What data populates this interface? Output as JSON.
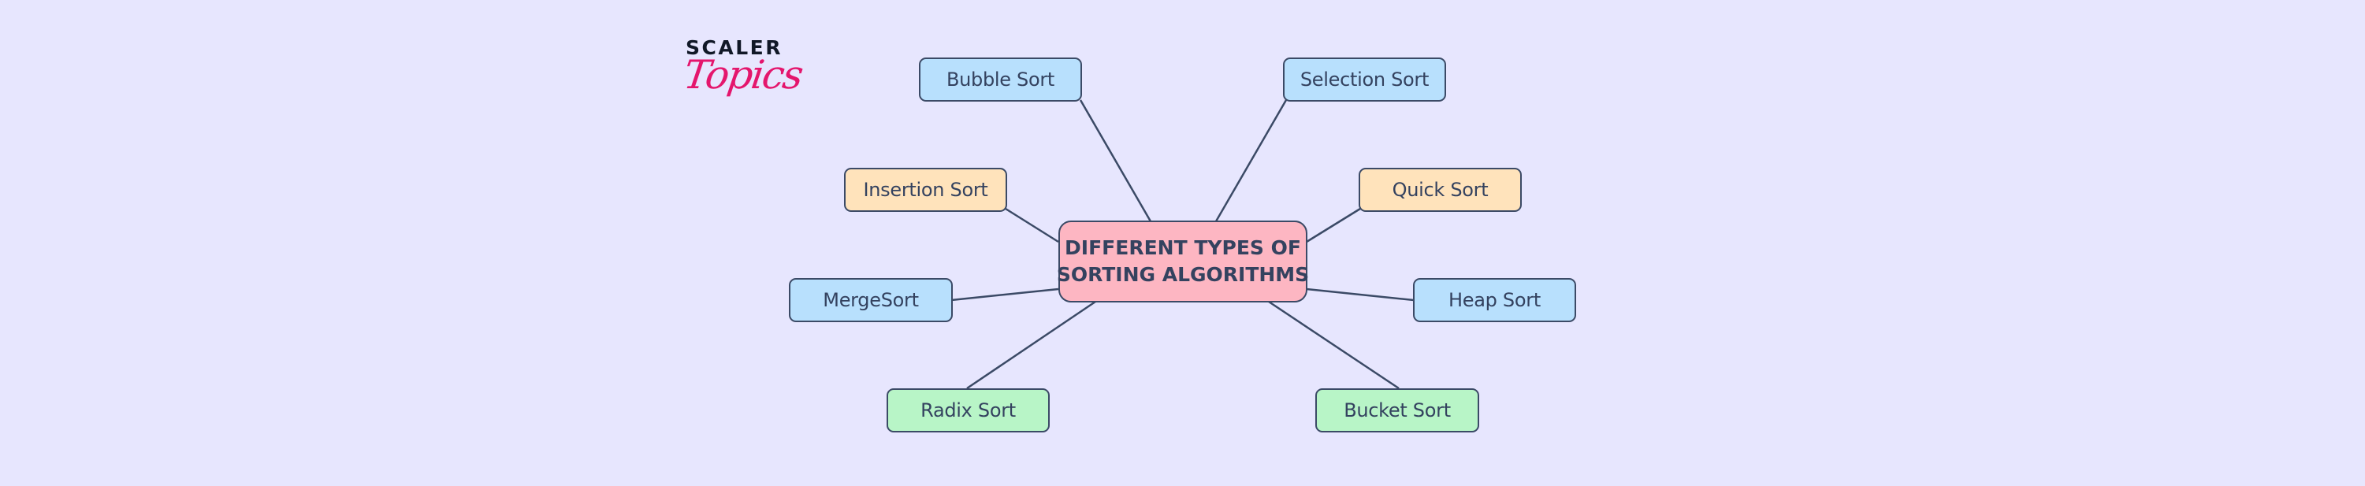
{
  "logo": {
    "word": "SCALER",
    "script": "Topics",
    "word_color": "#111827",
    "script_color": "#e4166d"
  },
  "diagram": {
    "background": "#e7e6fe",
    "edge_color": "#3b4a66",
    "center": {
      "id": "center",
      "line1": "DIFFERENT TYPES OF",
      "line2": "SORTING ALGORITHMS",
      "fill": "#fdb6c2"
    },
    "nodes": [
      {
        "id": "bubble-sort",
        "label": "Bubble Sort",
        "fill": "#b8e0fd"
      },
      {
        "id": "selection-sort",
        "label": "Selection Sort",
        "fill": "#b8e0fd"
      },
      {
        "id": "insertion-sort",
        "label": "Insertion Sort",
        "fill": "#ffe3bb"
      },
      {
        "id": "quick-sort",
        "label": "Quick Sort",
        "fill": "#ffe3bb"
      },
      {
        "id": "merge-sort",
        "label": "MergeSort",
        "fill": "#b8e0fd"
      },
      {
        "id": "heap-sort",
        "label": "Heap Sort",
        "fill": "#b8e0fd"
      },
      {
        "id": "radix-sort",
        "label": "Radix Sort",
        "fill": "#b8f5c7"
      },
      {
        "id": "bucket-sort",
        "label": "Bucket Sort",
        "fill": "#b8f5c7"
      }
    ],
    "edges": [
      {
        "from": "center",
        "to": "bubble-sort"
      },
      {
        "from": "center",
        "to": "selection-sort"
      },
      {
        "from": "center",
        "to": "insertion-sort"
      },
      {
        "from": "center",
        "to": "quick-sort"
      },
      {
        "from": "center",
        "to": "merge-sort"
      },
      {
        "from": "center",
        "to": "heap-sort"
      },
      {
        "from": "center",
        "to": "radix-sort"
      },
      {
        "from": "center",
        "to": "bucket-sort"
      }
    ]
  }
}
